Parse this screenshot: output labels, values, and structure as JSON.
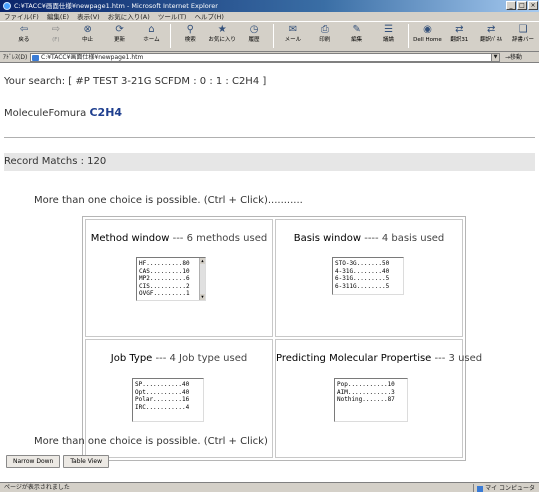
{
  "window": {
    "title": "C:¥TACC¥画面仕様¥newpage1.htm - Microsoft Internet Explorer",
    "controls": [
      "_",
      "□",
      "×"
    ]
  },
  "menu": [
    "ファイル(F)",
    "編集(E)",
    "表示(V)",
    "お気に入り(A)",
    "ツール(T)",
    "ヘルプ(H)"
  ],
  "toolbar": [
    {
      "icon": "back-arrow",
      "glyph": "⇦",
      "label": "戻る",
      "disabled": false
    },
    {
      "icon": "forward-arrow",
      "glyph": "⇨",
      "label": "(F)",
      "disabled": true
    },
    {
      "icon": "stop",
      "glyph": "⊗",
      "label": "中止",
      "disabled": false
    },
    {
      "icon": "refresh",
      "glyph": "⟳",
      "label": "更新",
      "disabled": false
    },
    {
      "icon": "home",
      "glyph": "⌂",
      "label": "ホーム",
      "disabled": false
    },
    {
      "icon": "search",
      "glyph": "⚲",
      "label": "検索",
      "disabled": false
    },
    {
      "icon": "favorites",
      "glyph": "★",
      "label": "お気に入り",
      "disabled": false
    },
    {
      "icon": "history",
      "glyph": "◷",
      "label": "履歴",
      "disabled": false
    },
    {
      "icon": "mail",
      "glyph": "✉",
      "label": "メール",
      "disabled": false
    },
    {
      "icon": "print",
      "glyph": "⎙",
      "label": "印刷",
      "disabled": false
    },
    {
      "icon": "edit",
      "glyph": "✎",
      "label": "編集",
      "disabled": false
    },
    {
      "icon": "discuss",
      "glyph": "☰",
      "label": "議論",
      "disabled": false
    },
    {
      "icon": "dell-home",
      "glyph": "◉",
      "label": "Dell Home",
      "disabled": false
    },
    {
      "icon": "translate",
      "glyph": "⇄",
      "label": "翻訳31",
      "disabled": false
    },
    {
      "icon": "translate-page",
      "glyph": "⇄",
      "label": "翻訳ﾊﾟﾈﾙ",
      "disabled": false
    },
    {
      "icon": "dictionary",
      "glyph": "❑",
      "label": "辞書バー",
      "disabled": false
    }
  ],
  "address": {
    "label": "ｱﾄﾞﾚｽ(D)",
    "value": "C:¥TACC¥画面仕様¥newpage1.htm",
    "go": "移動"
  },
  "page": {
    "search_text": "Your search: [ #P TEST 3-21G SCFDM : 0 : 1 : C2H4 ]",
    "formula_label": "MoleculeFomura",
    "formula_value": "C2H4",
    "record_matchs": "Record Matchs : 120",
    "hint_top": "More than one choice is possible. (Ctrl + Click)...........",
    "hint_bottom": "More than one choice is possible. (Ctrl + Click)"
  },
  "panels": {
    "method": {
      "title": "Method window",
      "count_text": "--- 6 methods used",
      "items": [
        "HF..........80",
        "CAS.........10",
        "MP2..........6",
        "CIS..........2",
        "OVGF.........1"
      ]
    },
    "basis": {
      "title": "Basis window",
      "count_text": "---- 4 basis used",
      "items": [
        "STO-3G.......50",
        "4-31G........40",
        "6-31G.........5",
        "6-311G........5"
      ]
    },
    "job": {
      "title": "Job Type",
      "count_text": "--- 4 Job type used",
      "items": [
        "SP...........40",
        "Opt..........40",
        "Polar........16",
        "IRC...........4"
      ]
    },
    "predict": {
      "title": "Predicting Molecular Propertise",
      "count_text": "--- 3  used",
      "items": [
        "Pop...........10",
        "AIM............3",
        "Nothing.......87"
      ]
    }
  },
  "buttons": {
    "narrow_down": "Narrow Down",
    "table_view": "Table View"
  },
  "status": {
    "text": "ページが表示されました",
    "zone": "マイ コンピュータ"
  }
}
